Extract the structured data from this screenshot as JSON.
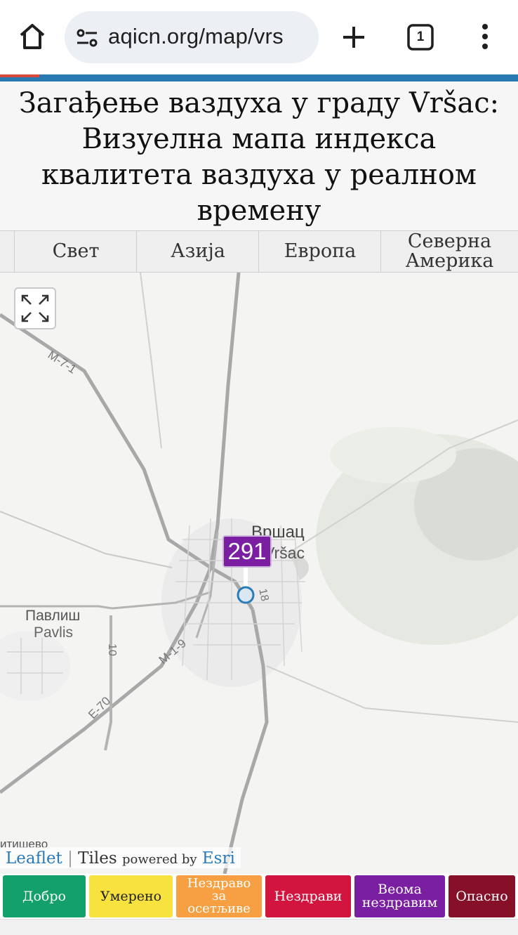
{
  "browser": {
    "url": "aqicn.org/map/vrs",
    "tab_count": "1"
  },
  "page": {
    "title": "Загађење ваздуха у граду Vršac: Визуелна мапа индекса квалитета ваздуха у реалном времену"
  },
  "region_tabs": [
    {
      "label": "Свет"
    },
    {
      "label": "Азија"
    },
    {
      "label": "Европа"
    },
    {
      "label": "Северна Америка"
    }
  ],
  "map": {
    "labels": {
      "city_cyrillic": "Вршац",
      "city_latin": "Vršac",
      "town_cyrillic": "Павлиш",
      "town_latin": "Pavlis",
      "partial_place": "итишево",
      "road_m71": "M-7-1",
      "road_m19": "M-1-9",
      "road_e70": "E-70",
      "road_10": "10",
      "road_18": "18"
    },
    "aqi_marker": {
      "value": "291",
      "color": "#7a1fa2"
    },
    "attribution": {
      "leaflet": "Leaflet",
      "separator": "|",
      "tiles": "Tiles",
      "powered_by": "powered by",
      "esri": "Esri"
    }
  },
  "legend": [
    {
      "label": "Добро",
      "color": "#14a06b"
    },
    {
      "label": "Умерено",
      "color": "#f7e23f"
    },
    {
      "label": "Нездраво за осетљиве",
      "color": "#f7a043"
    },
    {
      "label": "Нездрави",
      "color": "#d2153f"
    },
    {
      "label": "Веома нездравим",
      "color": "#7a1fa2"
    },
    {
      "label": "Опасно",
      "color": "#861028"
    }
  ]
}
